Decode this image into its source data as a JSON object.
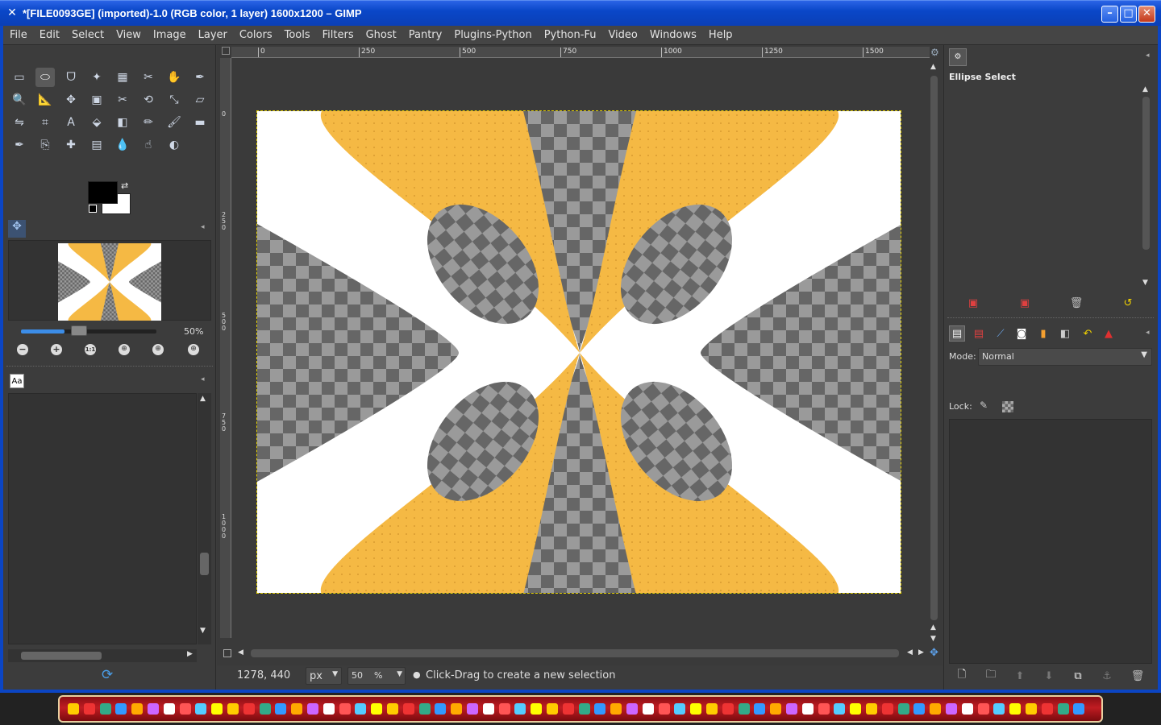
{
  "window": {
    "title": "*[FILE0093GE] (imported)-1.0 (RGB color, 1 layer) 1600x1200 – GIMP",
    "app_icon": "gimp-wilber-icon",
    "minimize_glyph": "–",
    "maximize_glyph": "□",
    "close_glyph": "✕"
  },
  "menu": [
    "File",
    "Edit",
    "Select",
    "View",
    "Image",
    "Layer",
    "Colors",
    "Tools",
    "Filters",
    "Ghost",
    "Pantry",
    "Plugins-Python",
    "Python-Fu",
    "Video",
    "Windows",
    "Help"
  ],
  "toolbox": {
    "tools": [
      "rect-select",
      "ellipse-select",
      "free-select",
      "fuzzy-select",
      "select-by-color",
      "scissors",
      "foreground-select",
      "paths",
      "color-picker",
      "zoom",
      "measure",
      "move",
      "align",
      "crop",
      "rotate",
      "scale",
      "shear",
      "perspective",
      "flip",
      "cage",
      "text",
      "bucket-fill",
      "blend",
      "pencil",
      "paintbrush",
      "eraser",
      "airbrush",
      "ink",
      "clone",
      "heal",
      "perspective-clone",
      "blur",
      "smudge",
      "dodge-burn"
    ],
    "active_tool": "ellipse-select",
    "fg_color": "#000000",
    "bg_color": "#ffffff"
  },
  "navigation": {
    "zoom_label": "50%",
    "zoom_fraction": 0.5
  },
  "font_panel": {
    "tab_label": "Aa"
  },
  "ruler": {
    "h_ticks": [
      "0",
      "250",
      "500",
      "750",
      "1000",
      "1250",
      "1500"
    ],
    "v_ticks": [
      "0",
      "250",
      "500",
      "750",
      "1000"
    ]
  },
  "status": {
    "coords": "1278, 440",
    "unit": "px",
    "zoom": "50",
    "zoom_suffix": "%",
    "message": "Click-Drag to create a new selection"
  },
  "tool_options": {
    "title": "Ellipse Select"
  },
  "layers": {
    "mode_label": "Mode:",
    "mode_value": "Normal",
    "lock_label": "Lock:"
  },
  "colors": {
    "accent": "#f5b944",
    "checker_dark": "#666666",
    "checker_light": "#999999",
    "titlebar": "#0a47c8"
  }
}
